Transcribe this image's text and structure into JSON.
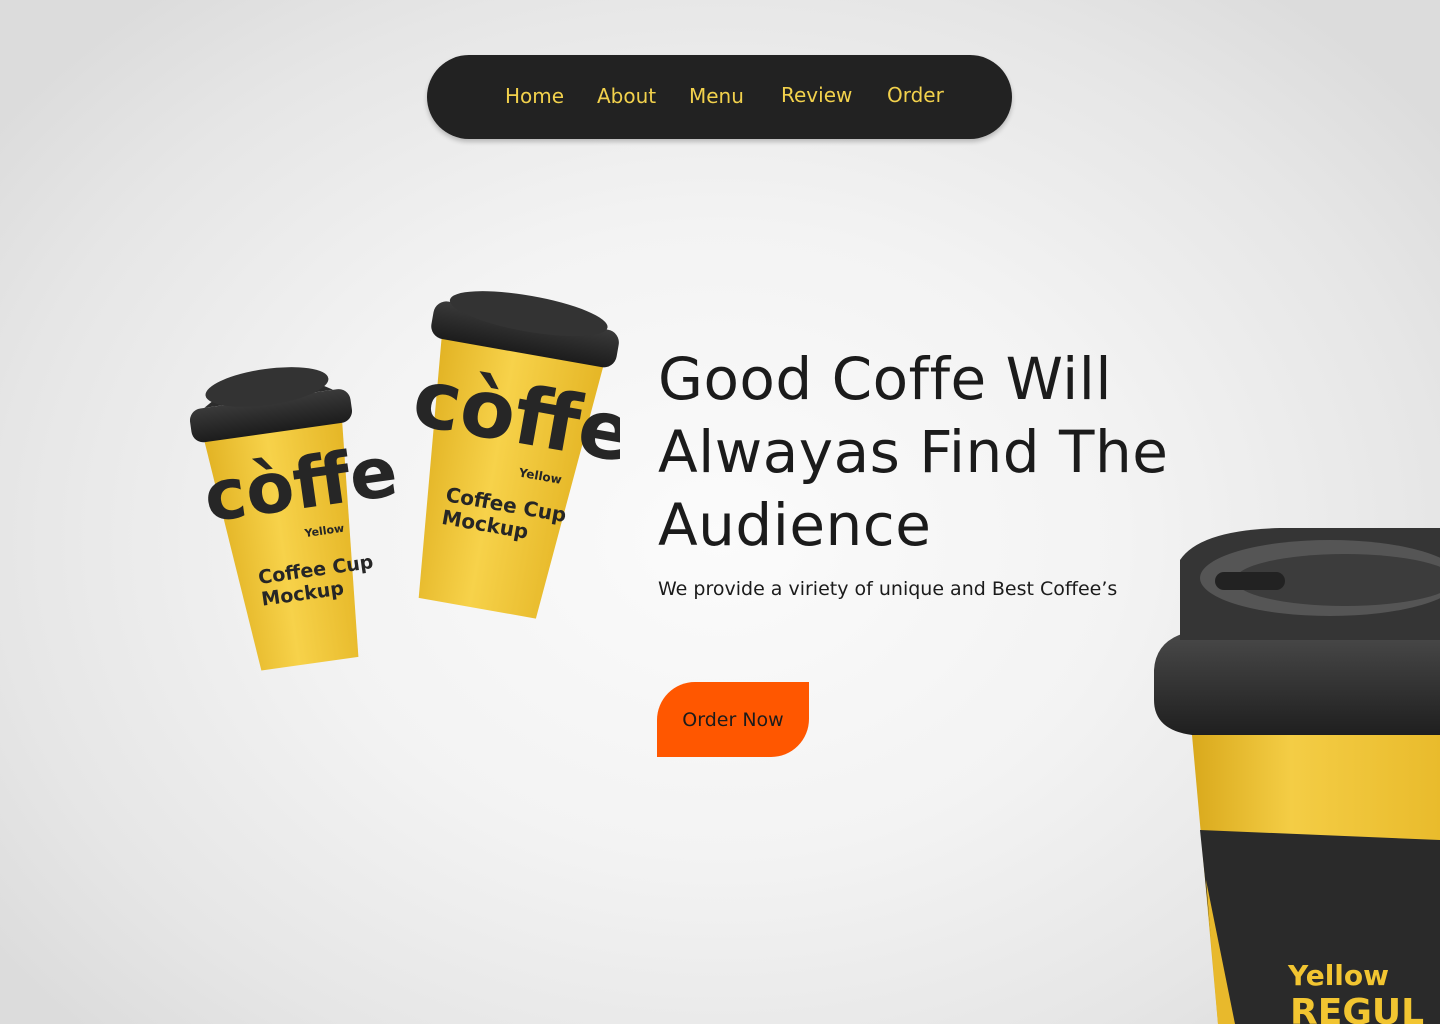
{
  "nav": {
    "items": [
      {
        "label": "Home"
      },
      {
        "label": "About"
      },
      {
        "label": "Menu"
      },
      {
        "label": "Review"
      },
      {
        "label": "Order"
      }
    ]
  },
  "hero": {
    "title_line1": "Good Coffe Will",
    "title_line2": "Alwayas Find The",
    "title_line3": "Audience",
    "subtitle": "We provide a viriety of unique and Best Coffee’s",
    "cta_label": "Order Now"
  },
  "cups": {
    "brand": "còffe",
    "variant": "Yellow",
    "caption_line1": "Coffee Cup",
    "caption_line2": "Mockup",
    "right_variant": "Yellow",
    "right_partial": "REGUL"
  },
  "colors": {
    "nav_bg": "#222222",
    "nav_text": "#f2d14c",
    "accent": "#ff5700",
    "cup_yellow": "#f2c531",
    "cup_lid": "#2b2b2b"
  }
}
